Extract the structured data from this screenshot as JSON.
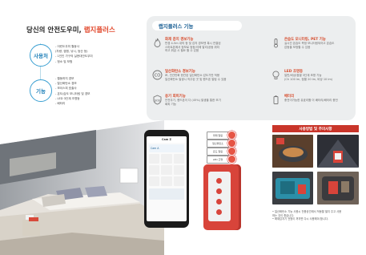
{
  "title": {
    "prefix": "당신의 안전도우미, ",
    "highlight": "랩지플러스"
  },
  "use_section": {
    "label": "사용처",
    "items": [
      "- 어린도우미 월동사",
      "(차량, 캠핑, 낚시, 등산 등)",
      "- 1인인 가구의 실현대안도우미",
      "- 청소 및 보험"
    ]
  },
  "func_section": {
    "label": "기능",
    "items": [
      "- 월동하지 경보",
      "- 탈산화탄소 경보",
      "- 보이스피 호출사",
      "- 온도/습도 모니터링 및 경보",
      "- LED 3단계 조명등",
      "- 배터리"
    ]
  },
  "features": {
    "title": "랩지플러스 기능",
    "items": [
      {
        "icon": "flame-icon",
        "name": "화재 감지 경보기능",
        "desc": [
          "반경 4-5m 내의 등 및 감지 경보엔 혹시 연결된",
          "스마트폰에서 정보로 등등/이에 알리/공동 위치",
          "하고 위급 시 필요 할 수 있음"
        ]
      },
      {
        "icon": "co-icon",
        "name": "일산화탄소 경보기능",
        "desc": [
          "IR, 인간탄화 현관된 일산화탄소 감도기반 적용",
          "일산화탄소 발생시 의주된 곳 및 핸드폰 알림 수 있음"
        ]
      },
      {
        "icon": "sos-icon",
        "name": "응기 회피기능",
        "desc": [
          "안전우기, 핸드폰이 다 (45%) 발생을 통한 모기",
          "회피 기능"
        ]
      },
      {
        "icon": "thermometer-icon",
        "name": "온습도 모니터링, PET 기능",
        "desc": [
          "실시간 온습도 측정 모니터링되어고 온습도",
          "감동을 보정할 수 있음"
        ]
      },
      {
        "icon": "bulb-icon",
        "name": "LED 조명등",
        "desc": [
          "일반/비상/점멸 3단계 조명 기능",
          "(Ch 100 lm, 점멸 20 lm, 비상 10 lm)"
        ]
      },
      {
        "icon": "battery-icon",
        "name": "배터리",
        "desc": [
          "충전이가능한 유효리튬 이 배터리/배터리 충전"
        ]
      }
    ]
  },
  "usage": {
    "title": "사용방법 및 주의사항",
    "notes": [
      "• 일산화탄소 기능 사용시 전용공간에서 작동할 필지 주고 사용",
      "  하는 것이 좋습니다.",
      "• 화재감지기 전원이 꺼지면 다시 사용해야 합니다."
    ]
  },
  "app": {
    "status": "Cam Z",
    "device": "Cam A",
    "callouts": [
      "화재 알림",
      "일산화탄소",
      "온도 알림",
      "LED 조명"
    ]
  },
  "colors": {
    "accent_red": "#d64b2b",
    "brand_blue": "#1a5f94",
    "panel_bg": "#eceeef"
  }
}
